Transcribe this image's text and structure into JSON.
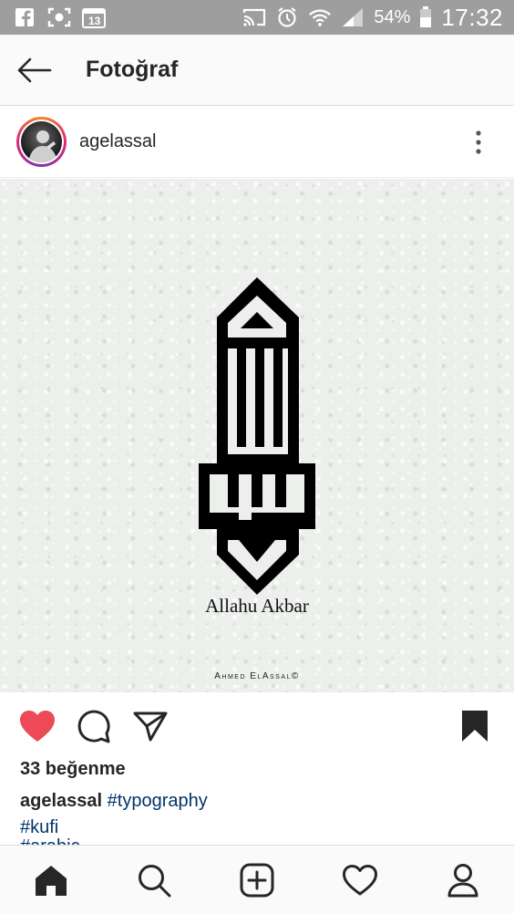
{
  "status_bar": {
    "battery": "54%",
    "time": "17:32",
    "notification_count": "13"
  },
  "app_bar": {
    "title": "Fotoğraf"
  },
  "post": {
    "username": "agelassal",
    "art_caption": "Allahu Akbar",
    "art_signature": "Ahmed ElAssal©",
    "likes": "33 beğenme",
    "caption_user": "agelassal",
    "hashtags": [
      "#typography",
      "#kufi",
      "#arabic"
    ]
  },
  "colors": {
    "like_red": "#ed4956",
    "hashtag_blue": "#003569",
    "status_bar_gray": "#9e9e9e"
  },
  "icons": {
    "status": [
      "facebook-icon",
      "screenshot-icon",
      "calendar-icon",
      "cast-icon",
      "alarm-icon",
      "wifi-icon",
      "signal-icon",
      "battery-icon"
    ],
    "nav": [
      "home-icon",
      "search-icon",
      "add-post-icon",
      "activity-heart-icon",
      "profile-icon"
    ]
  }
}
